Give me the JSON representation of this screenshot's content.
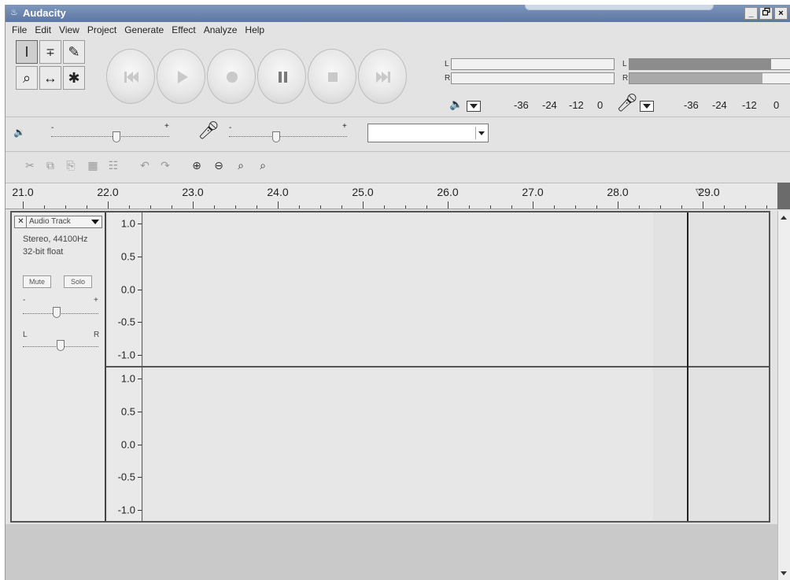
{
  "window": {
    "title": "Audacity",
    "controls": [
      "_",
      " ",
      "×"
    ]
  },
  "menu": [
    "File",
    "Edit",
    "View",
    "Project",
    "Generate",
    "Effect",
    "Analyze",
    "Help"
  ],
  "tools": [
    {
      "name": "selection-tool",
      "glyph": "I",
      "active": true
    },
    {
      "name": "envelope-tool",
      "glyph": "∓"
    },
    {
      "name": "draw-tool",
      "glyph": "✎"
    },
    {
      "name": "zoom-tool",
      "glyph": "⌕"
    },
    {
      "name": "timeshift-tool",
      "glyph": "↔"
    },
    {
      "name": "multi-tool",
      "glyph": "✱"
    }
  ],
  "meters": {
    "playback": {
      "channels": [
        "L",
        "R"
      ]
    },
    "record": {
      "channels": [
        "L",
        "R"
      ],
      "levels": [
        0.88,
        0.83
      ]
    },
    "scale": [
      "-36",
      "-24",
      "-12",
      "0"
    ]
  },
  "mixer": {
    "output_volume": 0.55,
    "input_volume": 0.4,
    "input_source": ""
  },
  "ruler": {
    "labels": [
      "21.0",
      "22.0",
      "23.0",
      "24.0",
      "25.0",
      "26.0",
      "27.0",
      "28.0",
      "29.0"
    ],
    "start": 21.0,
    "end": 29.8
  },
  "track": {
    "name": "Audio Track",
    "rate": "Stereo, 44100Hz",
    "format": "32-bit float",
    "mute_label": "Mute",
    "solo_label": "Solo",
    "gain_minus": "-",
    "gain_plus": "+",
    "pan_left": "L",
    "pan_right": "R",
    "gain": 0.45,
    "pan": 0.5,
    "amplitude_labels": [
      "1.0",
      "0.5",
      "0.0",
      "-0.5",
      "-1.0"
    ],
    "audio_end": 28.4,
    "cursor": 28.8
  },
  "colors": {
    "waveform": "#707070",
    "waveform_rms": "#9a9a9a",
    "titlebar": "#6a83ad"
  }
}
